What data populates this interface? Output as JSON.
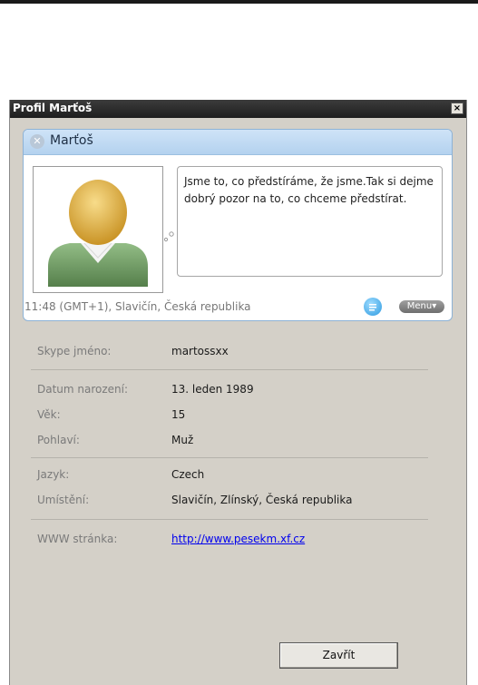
{
  "window": {
    "title": "Profil Marťoš",
    "close_glyph": "×"
  },
  "card": {
    "name": "Marťoš",
    "status_icon": "offline-status-icon",
    "mood": "Jsme to, co předstíráme, že jsme.Tak si dejme dobrý pozor na to, co chceme předstírat.",
    "location_time": "11:48 (GMT+1), Slavičín, Česká republika",
    "menu_label": "Menu▾"
  },
  "details": {
    "skype_label": "Skype jméno:",
    "skype_value": "martossxx",
    "birth_label": "Datum narození:",
    "birth_value": "13. leden 1989",
    "age_label": "Věk:",
    "age_value": "15",
    "gender_label": "Pohlaví:",
    "gender_value": "Muž",
    "language_label": "Jazyk:",
    "language_value": "Czech",
    "location_label": "Umístění:",
    "location_value": "Slavičín, Zlínský, Česká republika",
    "web_label": "WWW stránka:",
    "web_value": "http://www.pesekm.xf.cz"
  },
  "buttons": {
    "close_label": "Zavřít"
  },
  "colors": {
    "card_header": "#b4d2ef",
    "link": "#0000ee",
    "avatar_body": "#6f9a63",
    "avatar_head": "#e2b64a"
  }
}
